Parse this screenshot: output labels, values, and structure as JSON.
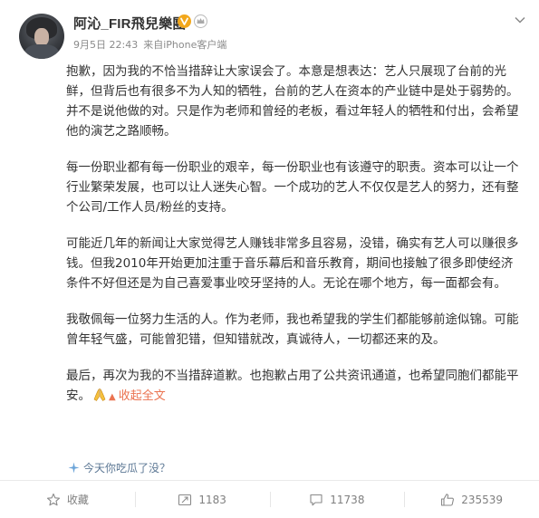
{
  "author": {
    "name": "阿沁_FIR飛兒樂團",
    "date": "9月5日 22:43",
    "source": "来自iPhone客户端"
  },
  "post": {
    "paragraphs": [
      "抱歉，因为我的不恰当措辞让大家误会了。本意是想表达：艺人只展现了台前的光鲜，但背后也有很多不为人知的牺牲，台前的艺人在资本的产业链中是处于弱势的。并不是说他做的对。只是作为老师和曾经的老板，看过年轻人的牺牲和付出，会希望他的演艺之路顺畅。",
      "每一份职业都有每一份职业的艰辛，每一份职业也有该遵守的职责。资本可以让一个行业繁荣发展，也可以让人迷失心智。一个成功的艺人不仅仅是艺人的努力，还有整个公司/工作人员/粉丝的支持。",
      "可能近几年的新闻让大家觉得艺人赚钱非常多且容易，没错，确实有艺人可以赚很多钱。但我2010年开始更加注重于音乐幕后和音乐教育，期间也接触了很多即使经济条件不好但还是为自己喜爱事业咬牙坚持的人。无论在哪个地方，每一面都会有。",
      "我敬佩每一位努力生活的人。作为老师，我也希望我的学生们都能够前途似锦。可能曾年轻气盛，可能曾犯错，但知错就改，真诚待人，一切都还来的及。",
      "最后，再次为我的不当措辞道歉。也抱歉占用了公共资讯通道，也希望同胞们都能平安。"
    ],
    "collapse_label": "收起全文",
    "topic": "今天你吃瓜了没？"
  },
  "actions": {
    "favorite": "收藏",
    "repost": "1183",
    "comment": "11738",
    "like": "235539"
  },
  "colors": {
    "link": "#eb7350",
    "topic": "#5d7895",
    "muted": "#808080"
  },
  "icons": [
    "avatar",
    "verified-v-badge-icon",
    "crown-icon",
    "chevron-down-icon",
    "praying-hands-emoji-icon",
    "sparkle-icon",
    "star-icon",
    "repost-icon",
    "comment-icon",
    "thumbs-up-icon"
  ]
}
